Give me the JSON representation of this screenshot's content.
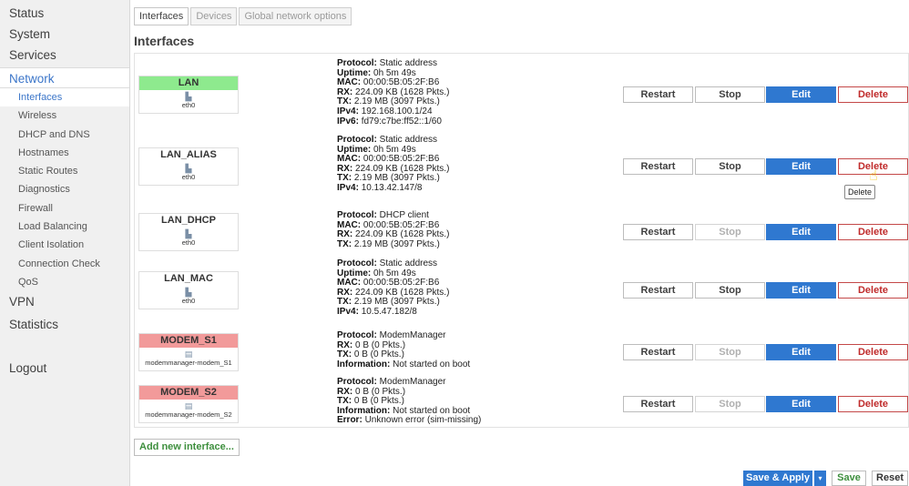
{
  "sidebar": {
    "status": "Status",
    "system": "System",
    "services": "Services",
    "network": "Network",
    "network_items": [
      "Interfaces",
      "Wireless",
      "DHCP and DNS",
      "Hostnames",
      "Static Routes",
      "Diagnostics",
      "Firewall",
      "Load Balancing",
      "Client Isolation",
      "Connection Check",
      "QoS"
    ],
    "vpn": "VPN",
    "statistics": "Statistics",
    "logout": "Logout"
  },
  "tabs": [
    "Interfaces",
    "Devices",
    "Global network options"
  ],
  "page_title": "Interfaces",
  "buttons": {
    "restart": "Restart",
    "stop": "Stop",
    "edit": "Edit",
    "delete": "Delete"
  },
  "interfaces": [
    {
      "name": "LAN",
      "device": "eth0",
      "icon": "network-port-icon",
      "badge_color": "#8eea8e",
      "info": [
        {
          "k": "Protocol:",
          "v": "Static address"
        },
        {
          "k": "Uptime:",
          "v": "0h 5m 49s"
        },
        {
          "k": "MAC:",
          "v": "00:00:5B:05:2F:B6"
        },
        {
          "k": "RX:",
          "v": "224.09 KB (1628 Pkts.)"
        },
        {
          "k": "TX:",
          "v": "2.19 MB (3097 Pkts.)"
        },
        {
          "k": "IPv4:",
          "v": "192.168.100.1/24"
        },
        {
          "k": "IPv6:",
          "v": "fd79:c7be:ff52::1/60"
        }
      ]
    },
    {
      "name": "LAN_ALIAS",
      "device": "eth0",
      "icon": "network-port-icon",
      "badge_color": "#ffffff",
      "info": [
        {
          "k": "Protocol:",
          "v": "Static address"
        },
        {
          "k": "Uptime:",
          "v": "0h 5m 49s"
        },
        {
          "k": "MAC:",
          "v": "00:00:5B:05:2F:B6"
        },
        {
          "k": "RX:",
          "v": "224.09 KB (1628 Pkts.)"
        },
        {
          "k": "TX:",
          "v": "2.19 MB (3097 Pkts.)"
        },
        {
          "k": "IPv4:",
          "v": "10.13.42.147/8"
        }
      ]
    },
    {
      "name": "LAN_DHCP",
      "device": "eth0",
      "icon": "network-port-icon",
      "badge_color": "#ffffff",
      "info": [
        {
          "k": "Protocol:",
          "v": "DHCP client"
        },
        {
          "k": "MAC:",
          "v": "00:00:5B:05:2F:B6"
        },
        {
          "k": "RX:",
          "v": "224.09 KB (1628 Pkts.)"
        },
        {
          "k": "TX:",
          "v": "2.19 MB (3097 Pkts.)"
        }
      ]
    },
    {
      "name": "LAN_MAC",
      "device": "eth0",
      "icon": "network-port-icon",
      "badge_color": "#ffffff",
      "info": [
        {
          "k": "Protocol:",
          "v": "Static address"
        },
        {
          "k": "Uptime:",
          "v": "0h 5m 49s"
        },
        {
          "k": "MAC:",
          "v": "00:00:5B:05:2F:B6"
        },
        {
          "k": "RX:",
          "v": "224.09 KB (1628 Pkts.)"
        },
        {
          "k": "TX:",
          "v": "2.19 MB (3097 Pkts.)"
        },
        {
          "k": "IPv4:",
          "v": "10.5.47.182/8"
        }
      ]
    },
    {
      "name": "MODEM_S1",
      "device": "modemmanager-modem_S1",
      "icon": "modem-icon",
      "badge_color": "#f29a9a",
      "info": [
        {
          "k": "Protocol:",
          "v": "ModemManager"
        },
        {
          "k": "RX:",
          "v": "0 B (0 Pkts.)"
        },
        {
          "k": "TX:",
          "v": "0 B (0 Pkts.)"
        },
        {
          "k": "Information:",
          "v": "Not started on boot"
        }
      ]
    },
    {
      "name": "MODEM_S2",
      "device": "modemmanager-modem_S2",
      "icon": "modem-icon",
      "badge_color": "#f29a9a",
      "info": [
        {
          "k": "Protocol:",
          "v": "ModemManager"
        },
        {
          "k": "RX:",
          "v": "0 B (0 Pkts.)"
        },
        {
          "k": "TX:",
          "v": "0 B (0 Pkts.)"
        },
        {
          "k": "Information:",
          "v": "Not started on boot"
        },
        {
          "k": "Error:",
          "v": "Unknown error (sim-missing)"
        }
      ]
    }
  ],
  "tooltip": "Delete",
  "add_interface": "Add new interface...",
  "footer": {
    "save_apply": "Save & Apply",
    "caret": "▾",
    "save": "Save",
    "reset": "Reset"
  },
  "colors": {
    "accent": "#2f78d0",
    "delete": "#c02b2b",
    "add": "#3e8f3e",
    "nav_active": "#3c76c9"
  }
}
